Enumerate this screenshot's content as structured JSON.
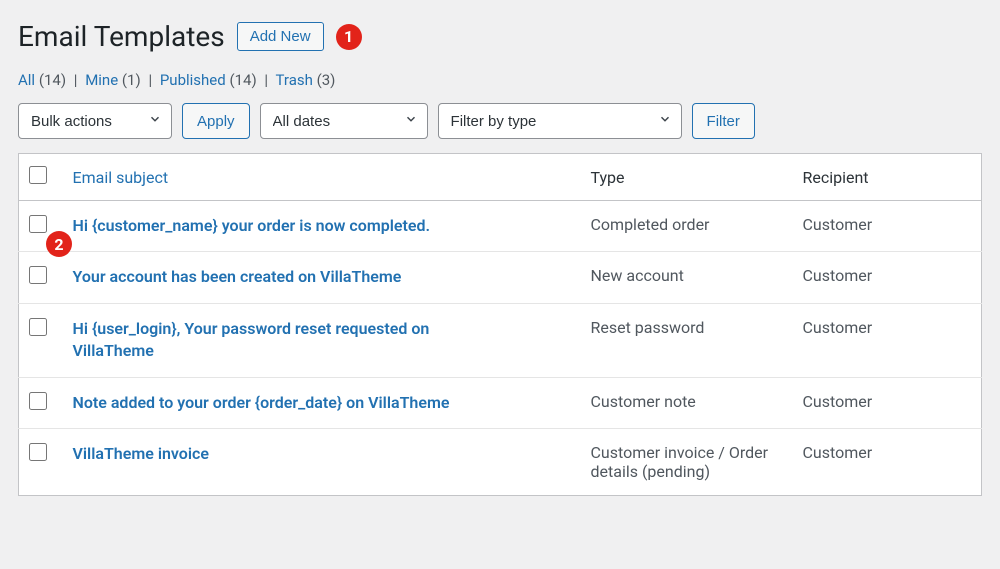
{
  "header": {
    "title": "Email Templates",
    "add_new_label": "Add New"
  },
  "annotations": {
    "badge1": "1",
    "badge2": "2"
  },
  "filters": {
    "links": [
      {
        "label": "All",
        "count": "(14)"
      },
      {
        "label": "Mine",
        "count": "(1)"
      },
      {
        "label": "Published",
        "count": "(14)"
      },
      {
        "label": "Trash",
        "count": "(3)"
      }
    ]
  },
  "tablenav": {
    "bulk_actions": "Bulk actions",
    "apply_label": "Apply",
    "all_dates": "All dates",
    "filter_type": "Filter by type",
    "filter_label": "Filter"
  },
  "columns": {
    "subject": "Email subject",
    "type": "Type",
    "recipient": "Recipient"
  },
  "rows": [
    {
      "subject": "Hi {customer_name} your order is now completed.",
      "type": "Completed order",
      "recipient": "Customer"
    },
    {
      "subject": "Your account has been created on VillaTheme",
      "type": "New account",
      "recipient": "Customer"
    },
    {
      "subject": "Hi {user_login}, Your password reset requested on VillaTheme",
      "type": "Reset password",
      "recipient": "Customer"
    },
    {
      "subject": "Note added to your order {order_date} on VillaTheme",
      "type": "Customer note",
      "recipient": "Customer"
    },
    {
      "subject": "VillaTheme invoice",
      "type": "Customer invoice / Order details (pending)",
      "recipient": "Customer"
    }
  ]
}
